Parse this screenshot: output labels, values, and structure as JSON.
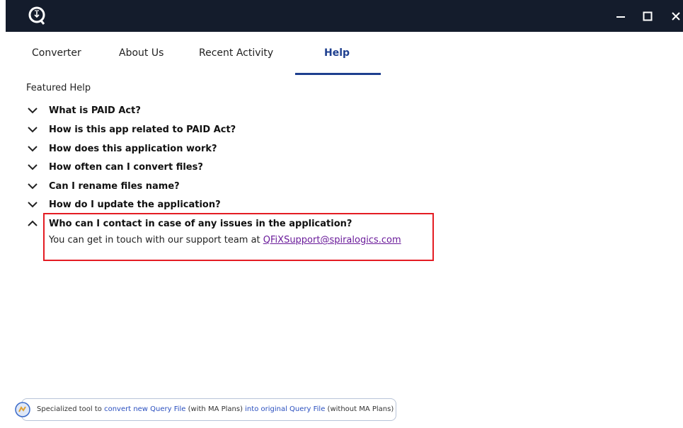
{
  "window": {
    "logo_icon": "q-logo-icon",
    "controls": [
      "minimize-icon",
      "maximize-icon",
      "close-icon"
    ]
  },
  "tabs": [
    {
      "label": "Converter",
      "active": false
    },
    {
      "label": "About Us",
      "active": false
    },
    {
      "label": "Recent Activity",
      "active": false
    },
    {
      "label": "Help",
      "active": true
    }
  ],
  "help": {
    "section_title": "Featured Help",
    "faqs": [
      {
        "question": "What is PAID Act?",
        "expanded": false
      },
      {
        "question": "How is this app related to PAID Act?",
        "expanded": false
      },
      {
        "question": "How does this application work?",
        "expanded": false
      },
      {
        "question": "How often can I convert files?",
        "expanded": false
      },
      {
        "question": "Can I rename files name?",
        "expanded": false
      },
      {
        "question": "How do I update the application?",
        "expanded": false
      },
      {
        "question": "Who can I contact in case of any issues in the application?",
        "expanded": true
      }
    ],
    "answer_prefix": "You can get in touch with our support team at ",
    "answer_link": "QFiXSupport@spiralogics.com"
  },
  "footer": {
    "text_1": "Specialized tool to ",
    "highlight_1": "convert new Query File",
    "text_2": " (with MA Plans) ",
    "highlight_2": "into original Query File",
    "text_3": " (without MA Plans)"
  },
  "colors": {
    "titlebar": "#141c2c",
    "accent": "#1e3f8f",
    "highlight_border": "#e41c23",
    "link": "#6a1b9a"
  }
}
